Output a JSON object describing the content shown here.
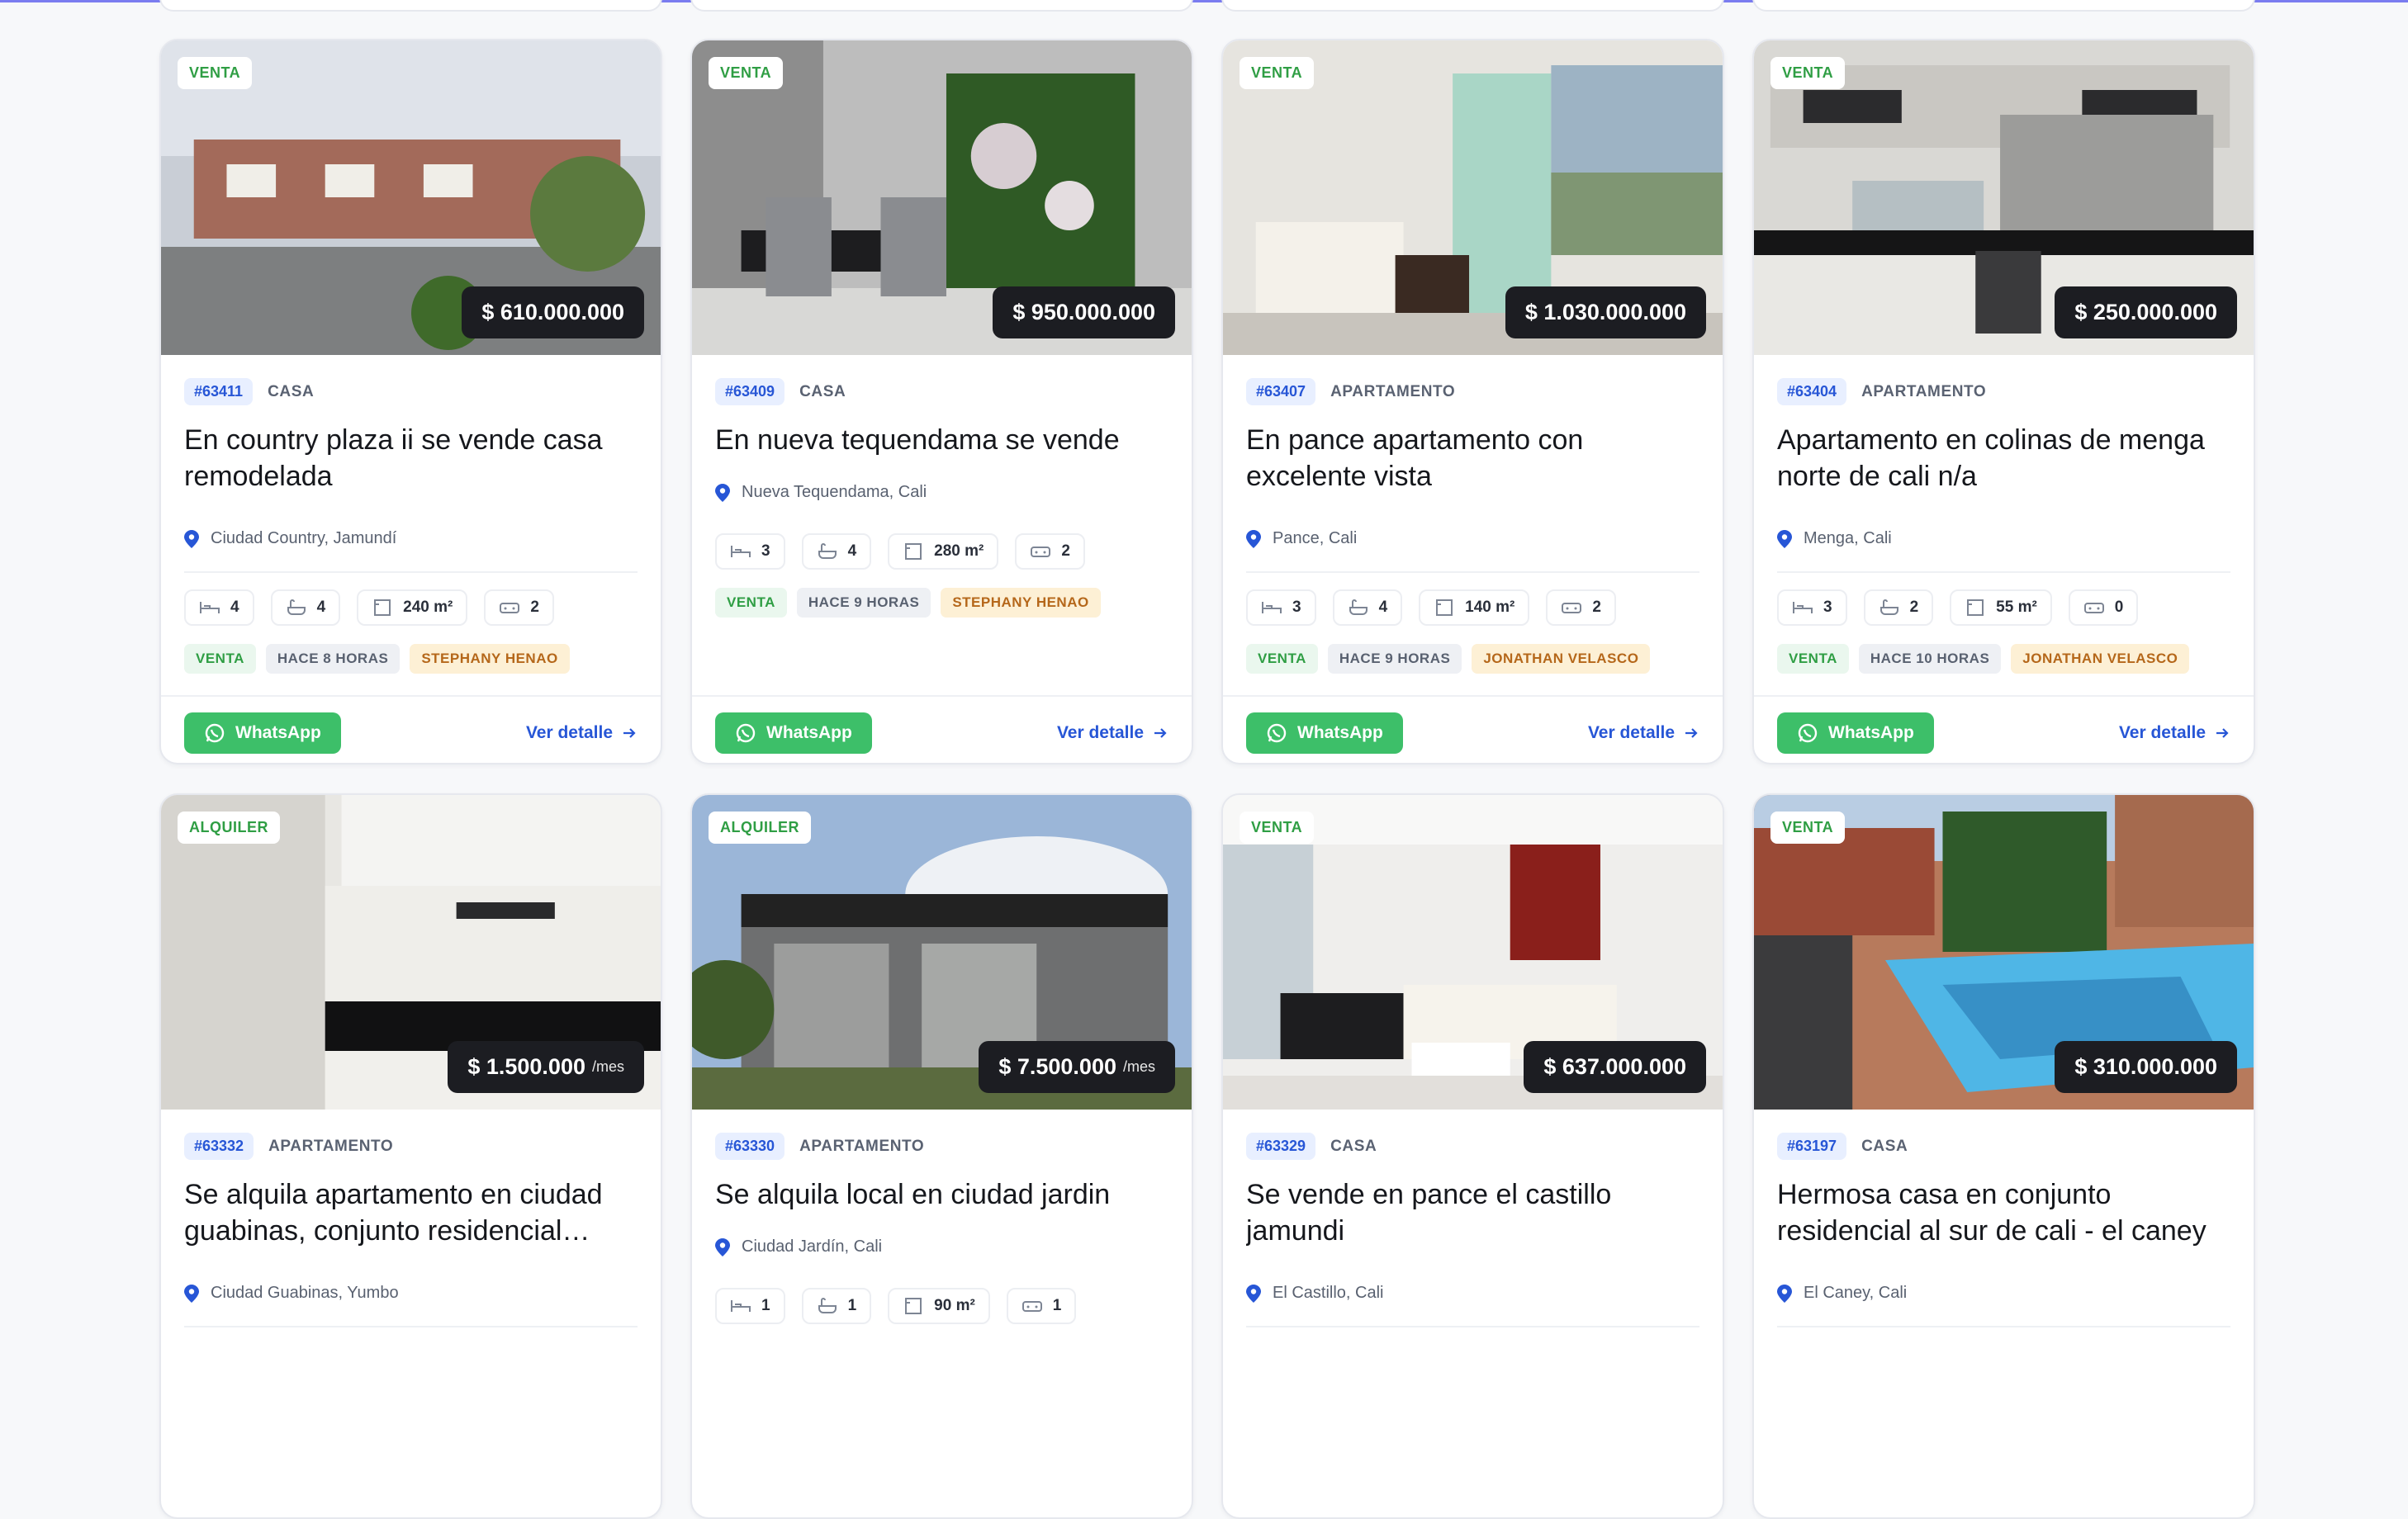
{
  "labels": {
    "whatsapp": "WhatsApp",
    "detail": "Ver detalle",
    "per_month": "/mes"
  },
  "colors": {
    "accent_blue": "#2756d6",
    "whatsapp_green": "#3dbf69",
    "sale_green": "#2f9e44",
    "agent_orange": "#b5671a"
  },
  "properties": [
    {
      "operation": "VENTA",
      "price": "$ 610.000.000",
      "per": "",
      "code": "#63411",
      "type": "CASA",
      "title": "En country plaza ii se vende casa remodelada",
      "location": "Ciudad Country, Jamundí",
      "beds": "4",
      "baths": "4",
      "area": "240 m²",
      "parking": "2",
      "status": "VENTA",
      "time": "HACE 8 HORAS",
      "agent": "STEPHANY HENAO"
    },
    {
      "operation": "VENTA",
      "price": "$ 950.000.000",
      "per": "",
      "code": "#63409",
      "type": "CASA",
      "title": "En nueva tequendama se vende casa",
      "location": "Nueva Tequendama, Cali",
      "beds": "3",
      "baths": "4",
      "area": "280 m²",
      "parking": "2",
      "status": "VENTA",
      "time": "HACE 9 HORAS",
      "agent": "STEPHANY HENAO"
    },
    {
      "operation": "VENTA",
      "price": "$ 1.030.000.000",
      "per": "",
      "code": "#63407",
      "type": "APARTAMENTO",
      "title": "En pance apartamento con excelente vista",
      "location": "Pance, Cali",
      "beds": "3",
      "baths": "4",
      "area": "140 m²",
      "parking": "2",
      "status": "VENTA",
      "time": "HACE 9 HORAS",
      "agent": "JONATHAN VELASCO"
    },
    {
      "operation": "VENTA",
      "price": "$ 250.000.000",
      "per": "",
      "code": "#63404",
      "type": "APARTAMENTO",
      "title": "Apartamento en colinas de menga norte de cali n/a",
      "location": "Menga, Cali",
      "beds": "3",
      "baths": "2",
      "area": "55 m²",
      "parking": "0",
      "status": "VENTA",
      "time": "HACE 10 HORAS",
      "agent": "JONATHAN VELASCO"
    },
    {
      "operation": "ALQUILER",
      "price": "$ 1.500.000",
      "per": "/mes",
      "code": "#63332",
      "type": "APARTAMENTO",
      "title": "Se alquila apartamento en ciudad guabinas, conjunto residencial…",
      "location": "Ciudad Guabinas, Yumbo",
      "beds": "",
      "baths": "",
      "area": "",
      "parking": "",
      "status": "",
      "time": "",
      "agent": ""
    },
    {
      "operation": "ALQUILER",
      "price": "$ 7.500.000",
      "per": "/mes",
      "code": "#63330",
      "type": "APARTAMENTO",
      "title": "Se alquila local en ciudad jardin",
      "location": "Ciudad Jardín, Cali",
      "beds": "1",
      "baths": "1",
      "area": "90 m²",
      "parking": "1",
      "status": "",
      "time": "",
      "agent": ""
    },
    {
      "operation": "VENTA",
      "price": "$ 637.000.000",
      "per": "",
      "code": "#63329",
      "type": "CASA",
      "title": "Se vende en pance el castillo jamundi",
      "location": "El Castillo, Cali",
      "beds": "",
      "baths": "",
      "area": "",
      "parking": "",
      "status": "",
      "time": "",
      "agent": ""
    },
    {
      "operation": "VENTA",
      "price": "$ 310.000.000",
      "per": "",
      "code": "#63197",
      "type": "CASA",
      "title": "Hermosa casa en conjunto residencial al sur de cali - el caney",
      "location": "El Caney, Cali",
      "beds": "",
      "baths": "",
      "area": "",
      "parking": "",
      "status": "",
      "time": "",
      "agent": ""
    }
  ]
}
